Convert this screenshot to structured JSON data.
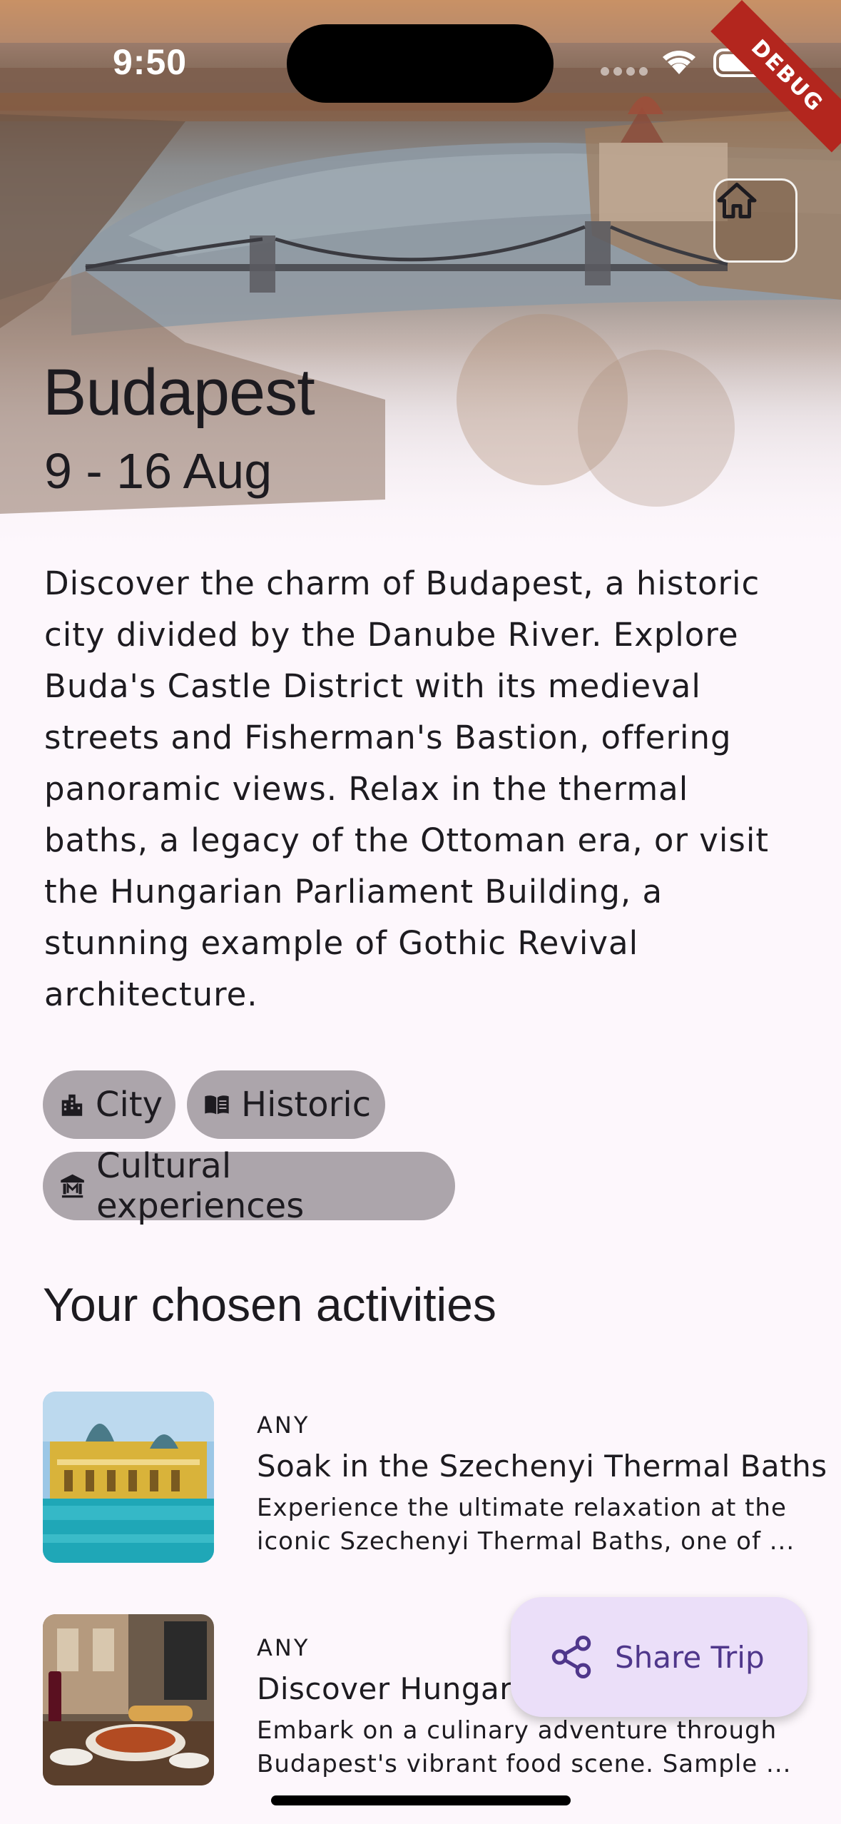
{
  "status_bar": {
    "time": "9:50",
    "debug_banner": "DEBUG"
  },
  "trip": {
    "title": "Budapest",
    "dates": "9 - 16 Aug",
    "description_lines": [
      "Discover the charm of Budapest, a historic",
      "city divided by the Danube River. Explore",
      "Buda's Castle District with its medieval",
      "streets and Fisherman's Bastion, offering",
      "panoramic views. Relax in the thermal",
      "baths, a legacy of the Ottoman era, or visit",
      "the Hungarian Parliament Building, a",
      "stunning example of Gothic Revival",
      "architecture."
    ]
  },
  "tags": [
    {
      "label": "City",
      "icon": "city-icon"
    },
    {
      "label": "Historic",
      "icon": "book-icon"
    },
    {
      "label": "Cultural experiences",
      "icon": "museum-icon"
    }
  ],
  "activities_section": {
    "title": "Your chosen activities"
  },
  "activities": [
    {
      "kind": "ANY",
      "name": "Soak in the Szechenyi Thermal Baths",
      "desc_lines": [
        "Experience the ultimate relaxation at the",
        "iconic Szechenyi Thermal Baths, one of ..."
      ]
    },
    {
      "kind": "ANY",
      "name": "Discover Hungaria",
      "desc_lines": [
        "Embark on a culinary adventure through",
        "Budapest's vibrant food scene. Sample ..."
      ]
    }
  ],
  "fab": {
    "label": "Share Trip",
    "icon": "share-icon"
  },
  "colors": {
    "background": "#fdf7fc",
    "chip": "#aca5ab",
    "fab": "#ebdff9",
    "fab_text": "#4f378b"
  }
}
